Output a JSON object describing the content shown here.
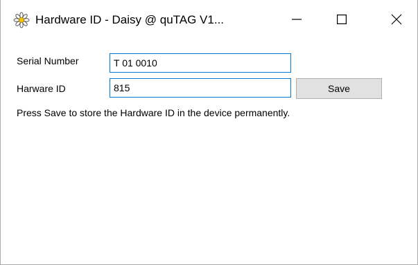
{
  "window": {
    "title": "Hardware ID - Daisy @ quTAG V1...",
    "icon": "daisy-flower-icon",
    "controls": {
      "minimize_icon": "minimize-icon",
      "maximize_icon": "maximize-icon",
      "close_icon": "close-icon"
    }
  },
  "form": {
    "serial_label": "Serial Number",
    "serial_value": "T 01 0010",
    "hardware_label": "Harware ID",
    "hardware_value": "815",
    "save_label": "Save",
    "hint": "Press Save to store the Hardware ID in the device permanently."
  },
  "colors": {
    "focus_border": "#0078d7",
    "button_face": "#e1e1e1",
    "button_border": "#adadad"
  }
}
